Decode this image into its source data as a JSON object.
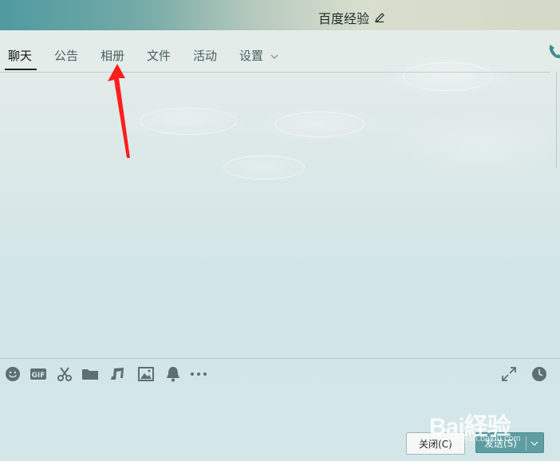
{
  "window": {
    "title": "百度经验"
  },
  "tabs": [
    {
      "label": "聊天",
      "active": true
    },
    {
      "label": "公告",
      "active": false
    },
    {
      "label": "相册",
      "active": false
    },
    {
      "label": "文件",
      "active": false
    },
    {
      "label": "活动",
      "active": false
    },
    {
      "label": "设置",
      "active": false
    }
  ],
  "toolbar_icons": [
    "emoji-icon",
    "gif-icon",
    "scissors-icon",
    "folder-icon",
    "music-icon",
    "image-icon",
    "bell-icon",
    "more-icon"
  ],
  "footer": {
    "close_label": "关闭(C)",
    "send_label": "发送(S)"
  },
  "watermark": {
    "main": "Bai経验",
    "sub": "jingyan.baidu.com"
  },
  "colors": {
    "accent": "#5e9ea2",
    "arrow": "#ff1d1d"
  }
}
